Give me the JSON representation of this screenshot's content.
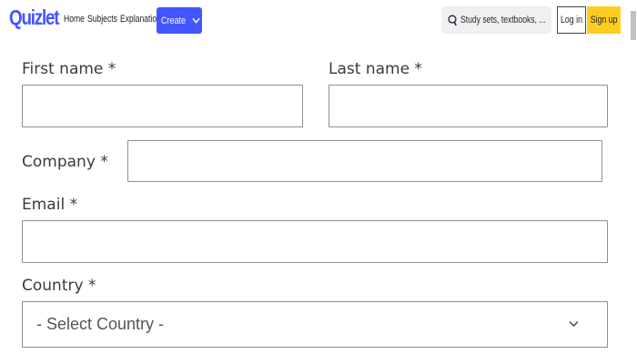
{
  "header": {
    "logo": "Quizlet",
    "nav": [
      "Home",
      "Subjects",
      "Explanations"
    ],
    "create_label": "Create",
    "search_placeholder": "Study sets, textbooks, ...",
    "login_label": "Log in",
    "signup_label": "Sign up",
    "brand_color": "#4255ff",
    "signup_color": "#ffcd1f"
  },
  "form": {
    "first_name": {
      "label": "First name *",
      "value": ""
    },
    "last_name": {
      "label": "Last name *",
      "value": ""
    },
    "company": {
      "label": "Company *",
      "value": ""
    },
    "email": {
      "label": "Email *",
      "value": ""
    },
    "country": {
      "label": "Country *",
      "selected": "- Select Country -"
    }
  },
  "icons": {
    "search": "search-icon",
    "create_chevron": "chevron-down-icon",
    "country_chevron": "chevron-down-icon"
  }
}
